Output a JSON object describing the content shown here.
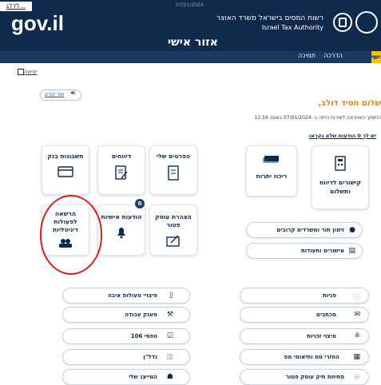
{
  "header": {
    "top_link": "לדלג...",
    "date_line": "07/01/2024",
    "logo": "gov.il",
    "authority_he": "רשות המסים בישראל משרד האוצר",
    "authority_en": "Israel Tax Authority",
    "page_title": "אזור אישי"
  },
  "nav": {
    "active": "אישי",
    "guide": "הדרכה",
    "support": "תמיכה"
  },
  "exit_label": "יציאה",
  "back_label": "עמ' קודם",
  "greeting": "שלום חסיד דולב,",
  "last_login": "כניסתך האחרונה לשירות היתה ב- 07/01/2024 בשעה 11:54",
  "unread": "יש לך 0 הודעות שלא נקראו",
  "cards": {
    "bank_accounts": "חשבונות בנק",
    "reports": "דיווחים",
    "my_details": "הפרטים שלי",
    "balance_summary": "ריכוז יתרות",
    "reporting_payment": "קישורים לדיווח ותשלום",
    "digital_authorization": "הרשאה לפעולות דיגיטליות",
    "personal_messages": "הודעות אישיות",
    "exempt_declaration": "הצהרת עוסק פטור",
    "messages_badge": "0"
  },
  "pills_right": {
    "appointment": "זימון תור ומשרדים קרובים",
    "certificates": "אישורים ותעודות",
    "inquiries": "פניות",
    "letters": "מכתבים",
    "credit_points": "מיצוי זכויות",
    "refunds": "החזרי מס ותיאומי מס",
    "open_file": "פתיחת תיק עוסק פטור"
  },
  "pills_left": {
    "freeze": "פיצויי פעולות איבה",
    "work_grant": "מענק עבודה",
    "form106": "טפסי 106",
    "realestate": "נדל\"ן",
    "my_rep": "המייצג שלי"
  },
  "colors": {
    "header_bg": "#0f2a4c",
    "accent": "#f3c400",
    "greeting": "#e0821a",
    "highlight": "#d52020"
  }
}
